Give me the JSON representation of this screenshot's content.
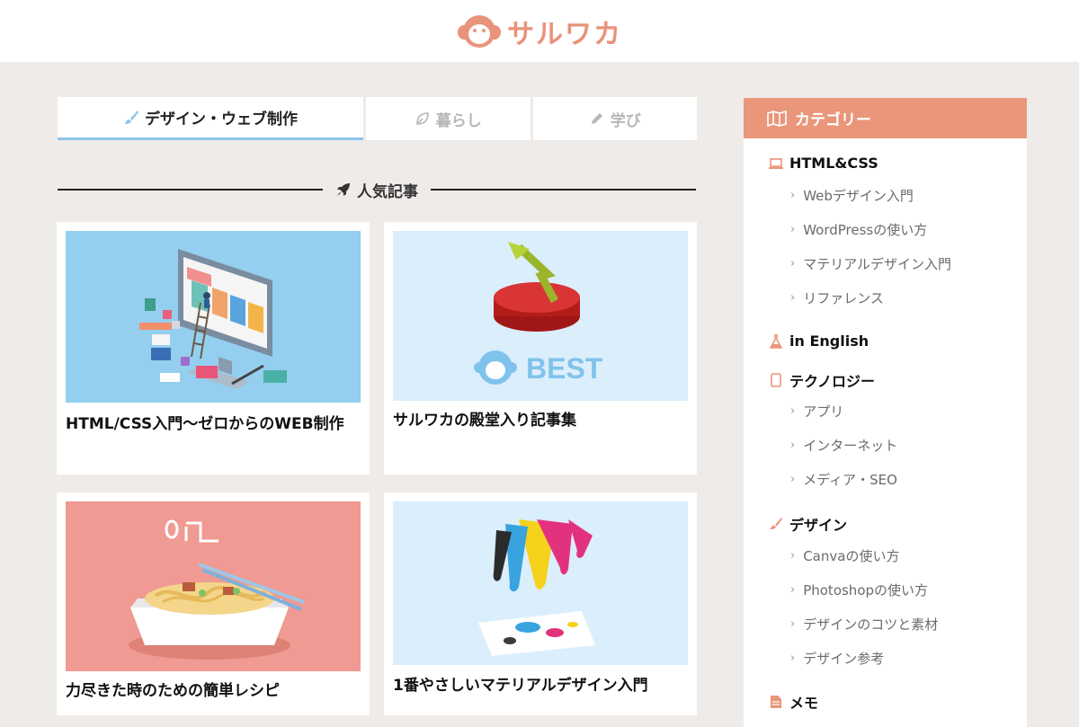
{
  "header": {
    "logo_text": "サルワカ"
  },
  "tabs": [
    {
      "label": "デザイン・ウェブ制作",
      "icon": "paintbrush-icon",
      "active": true
    },
    {
      "label": "暮らし",
      "icon": "leaf-icon",
      "active": false
    },
    {
      "label": "学び",
      "icon": "pencil-icon",
      "active": false
    }
  ],
  "section": {
    "title": "人気記事",
    "icon": "rocket-icon"
  },
  "cards": [
    {
      "title": "HTML/CSS入門〜ゼロからのWEB制作"
    },
    {
      "title": "サルワカの殿堂入り記事集",
      "image_text": "BEST"
    },
    {
      "title": "力尽きた時のための簡単レシピ"
    },
    {
      "title": "1番やさしいマテリアルデザイン入門"
    }
  ],
  "sidebar": {
    "title": "カテゴリー",
    "categories": [
      {
        "label": "HTML&CSS",
        "icon": "laptop-icon",
        "items": [
          "Webデザイン入門",
          "WordPressの使い方",
          "マテリアルデザイン入門",
          "リファレンス"
        ]
      },
      {
        "label": "in English",
        "icon": "flask-icon",
        "items": []
      },
      {
        "label": "テクノロジー",
        "icon": "tablet-icon",
        "items": [
          "アプリ",
          "インターネット",
          "メディア・SEO"
        ]
      },
      {
        "label": "デザイン",
        "icon": "paintbrush-icon",
        "items": [
          "Canvaの使い方",
          "Photoshopの使い方",
          "デザインのコツと素材",
          "デザイン参考"
        ]
      },
      {
        "label": "メモ",
        "icon": "document-icon",
        "items": []
      }
    ]
  },
  "colors": {
    "accent": "#e9967a",
    "tab_underline": "#8cc4ec",
    "background": "#efebe9"
  }
}
